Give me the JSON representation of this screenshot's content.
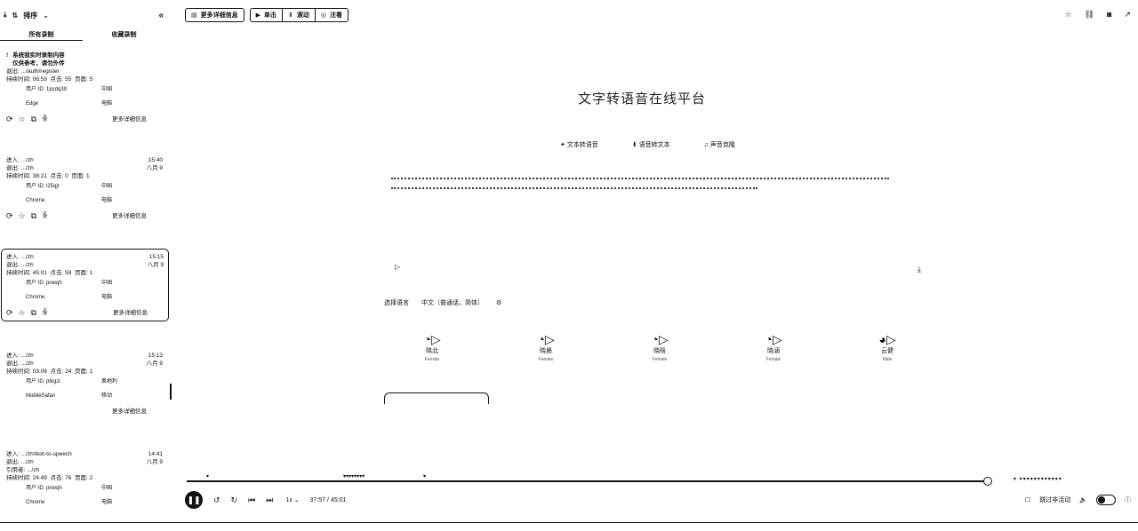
{
  "sidebar": {
    "sort_label": "排序",
    "tabs": [
      "所有录制",
      "收藏录制"
    ],
    "notice_title": "系统我实时录制内容",
    "notice_sub": "仅供参考，请勿外传",
    "cards": [
      {
        "enter": "",
        "exit": "退出: .../auth/register",
        "duration": "持续时间: 06:59",
        "clicks": "点击: 55",
        "pages": "页面: 5",
        "time": "",
        "date": "",
        "user": "用户 ID: 1pcdq39",
        "region": "中国",
        "browser": "Edge",
        "device": "电脑",
        "more": "更多详细信息"
      },
      {
        "enter": "进入: .../zh",
        "exit": "退出: .../zh",
        "duration": "持续时间: 38:21",
        "clicks": "点击: 0",
        "pages": "页面: 1",
        "time": "15:40",
        "date": "八月 9",
        "user": "用户 ID: l25qjt",
        "region": "中国",
        "browser": "Chrome",
        "device": "电脑",
        "more": "更多详细信息"
      },
      {
        "enter": "进入: .../zh",
        "exit": "退出: .../zh",
        "duration": "持续时间: 45:01",
        "clicks": "点击: 59",
        "pages": "页面: 1",
        "time": "15:15",
        "date": "八月 9",
        "user": "用户 ID: pnwqh",
        "region": "中国",
        "browser": "Chrome",
        "device": "电脑",
        "more": "更多详细信息"
      },
      {
        "enter": "进入: .../zh",
        "exit": "退出: .../zh",
        "duration": "持续时间: 03:06",
        "clicks": "点击: 24",
        "pages": "页面: 1",
        "time": "15:13",
        "date": "八月 9",
        "user": "用户 ID: ptkgzl",
        "region": "奥地利",
        "browser": "MobileSafari",
        "device": "移动",
        "more": "更多详细信息"
      },
      {
        "enter": "进入: .../zh/text-to-speech",
        "exit": "退出: .../zh",
        "referrer": "引用者: .../zh",
        "duration": "持续时间: 24:49",
        "clicks": "点击: 76",
        "pages": "页面: 2",
        "time": "14:41",
        "date": "八月 9",
        "user": "用户 ID: pnwqh",
        "region": "中国",
        "browser": "Chrome",
        "device": "电脑"
      }
    ]
  },
  "toolbar": {
    "details_label": "更多详细信息",
    "click_label": "单击",
    "scroll_label": "滚动",
    "note_label": "注看"
  },
  "main": {
    "title": "文字转语音在线平台",
    "modes": [
      "文本转语音",
      "语音转文本",
      "声音克隆"
    ],
    "settings": [
      "选择语言",
      "中文（普通话，简体）"
    ],
    "voices": [
      {
        "name": "晓北",
        "gender": "Female"
      },
      {
        "name": "晓晨",
        "gender": "Female"
      },
      {
        "name": "晓晗",
        "gender": "Female"
      },
      {
        "name": "晓涵",
        "gender": "Female"
      },
      {
        "name": "云健",
        "gender": "Male"
      }
    ]
  },
  "player": {
    "time": "37:57 / 45:01",
    "rate": "1x",
    "skip_label": "跳过非活动",
    "progress": 0.843
  }
}
